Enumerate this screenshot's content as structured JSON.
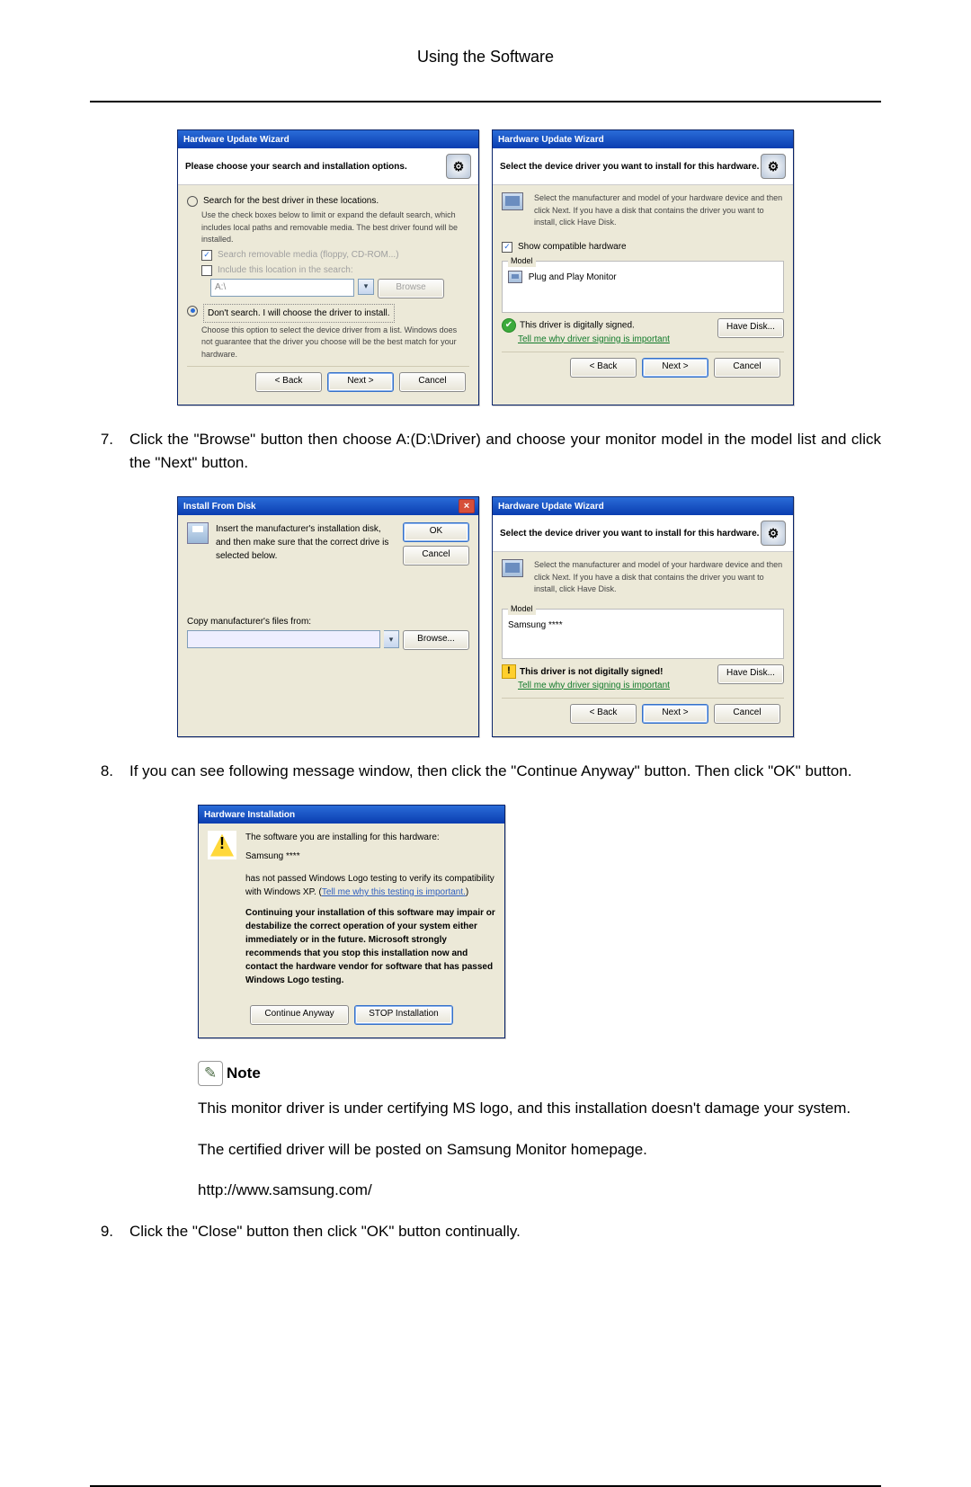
{
  "header": {
    "title": "Using the Software"
  },
  "dialogs": {
    "huw_search": {
      "title": "Hardware Update Wizard",
      "headline": "Please choose your search and installation options.",
      "opt_search": "Search for the best driver in these locations.",
      "opt_search_desc": "Use the check boxes below to limit or expand the default search, which includes local paths and removable media. The best driver found will be installed.",
      "chk_media": "Search removable media (floppy, CD-ROM...)",
      "chk_include": "Include this location in the search:",
      "path_value": "A:\\",
      "browse_btn": "Browse",
      "opt_noSearch": "Don't search. I will choose the driver to install.",
      "opt_noSearch_desc": "Choose this option to select the device driver from a list. Windows does not guarantee that the driver you choose will be the best match for your hardware.",
      "back": "< Back",
      "next": "Next >",
      "cancel": "Cancel"
    },
    "huw_select1": {
      "title": "Hardware Update Wizard",
      "headline": "Select the device driver you want to install for this hardware.",
      "desc": "Select the manufacturer and model of your hardware device and then click Next. If you have a disk that contains the driver you want to install, click Have Disk.",
      "chk_compat": "Show compatible hardware",
      "group_model": "Model",
      "model_item": "Plug and Play Monitor",
      "signed": "This driver is digitally signed.",
      "tell_why": "Tell me why driver signing is important",
      "have_disk": "Have Disk...",
      "back": "< Back",
      "next": "Next >",
      "cancel": "Cancel"
    },
    "install_from_disk": {
      "title": "Install From Disk",
      "msg": "Insert the manufacturer's installation disk, and then make sure that the correct drive is selected below.",
      "ok": "OK",
      "cancel": "Cancel",
      "copy_label": "Copy manufacturer's files from:",
      "path": "",
      "browse": "Browse..."
    },
    "huw_select2": {
      "title": "Hardware Update Wizard",
      "headline": "Select the device driver you want to install for this hardware.",
      "desc": "Select the manufacturer and model of your hardware device and then click Next. If you have a disk that contains the driver you want to install, click Have Disk.",
      "group_model": "Model",
      "model_item": "Samsung ****",
      "unsigned": "This driver is not digitally signed!",
      "tell_why": "Tell me why driver signing is important",
      "have_disk": "Have Disk...",
      "back": "< Back",
      "next": "Next >",
      "cancel": "Cancel"
    },
    "hw_install": {
      "title": "Hardware Installation",
      "line1": "The software you are installing for this hardware:",
      "line2": "Samsung ****",
      "line3a": "has not passed Windows Logo testing to verify its compatibility with Windows XP. (",
      "line3link": "Tell me why this testing is important.",
      "line3b": ")",
      "warn": "Continuing your installation of this software may impair or destabilize the correct operation of your system either immediately or in the future. Microsoft strongly recommends that you stop this installation now and contact the hardware vendor for software that has passed Windows Logo testing.",
      "continue": "Continue Anyway",
      "stop": "STOP Installation"
    }
  },
  "steps": {
    "s7_num": "7.",
    "s7_text": "Click the \"Browse\" button then choose A:(D:\\Driver) and choose your monitor model in the model list and click the \"Next\" button.",
    "s8_num": "8.",
    "s8_text": "If you can see following message window, then click the \"Continue Anyway\" button. Then click \"OK\" button.",
    "s9_num": "9.",
    "s9_text": "Click the \"Close\" button then click \"OK\" button continually."
  },
  "note": {
    "label": "Note",
    "p1": "This monitor driver is under certifying MS logo, and this installation doesn't damage your system.",
    "p2": "The certified driver will be posted on Samsung Monitor homepage.",
    "url": "http://www.samsung.com/"
  }
}
